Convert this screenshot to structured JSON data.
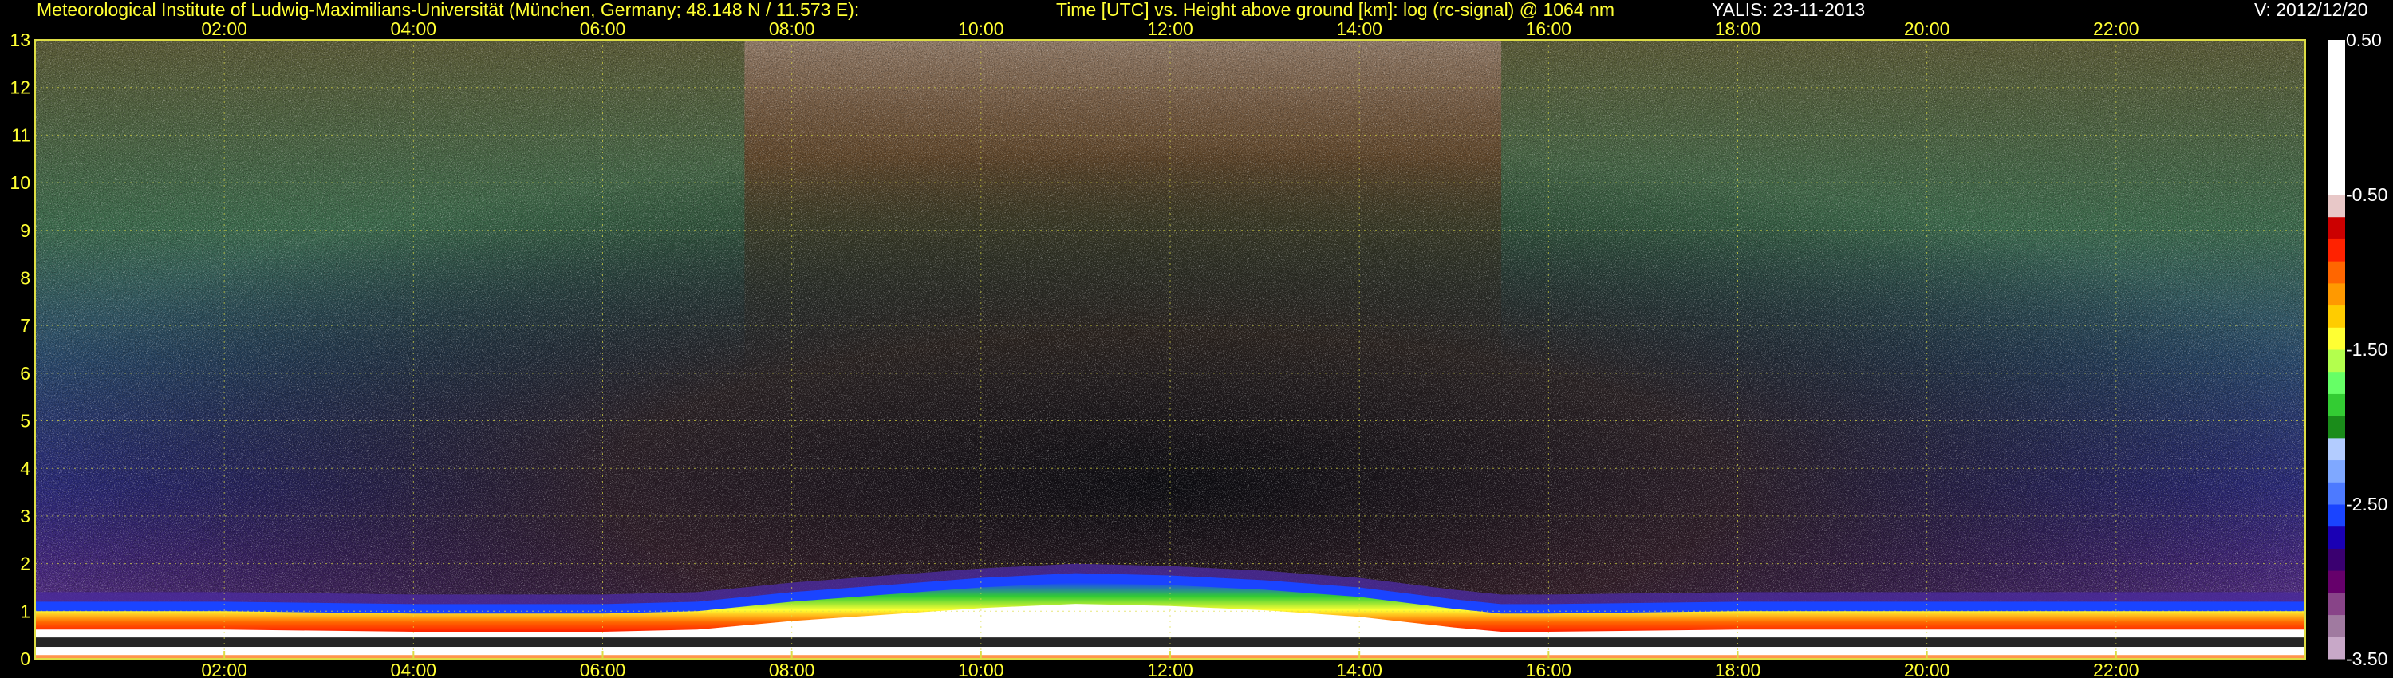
{
  "header": {
    "institute": "Meteorological Institute of Ludwig-Maximilians-Universität (München, Germany; 48.148 N / 11.573 E):",
    "plot_title": "Time [UTC] vs. Height above ground [km]: log (rc-signal) @ 1064 nm",
    "instrument_date": "YALIS: 23-11-2013",
    "version": "V: 2012/12/20"
  },
  "chart_data": {
    "type": "heatmap",
    "title": "Time [UTC] vs. Height above ground [km]: log (rc-signal) @ 1064 nm",
    "x_ticks": [
      "02:00",
      "04:00",
      "06:00",
      "08:00",
      "10:00",
      "12:00",
      "14:00",
      "16:00",
      "18:00",
      "20:00",
      "22:00"
    ],
    "x_tick_hours": [
      2,
      4,
      6,
      8,
      10,
      12,
      14,
      16,
      18,
      20,
      22
    ],
    "xlim": [
      0,
      24
    ],
    "y_ticks": [
      "0",
      "1",
      "2",
      "3",
      "4",
      "5",
      "6",
      "7",
      "8",
      "9",
      "10",
      "11",
      "12",
      "13"
    ],
    "ylim": [
      0,
      13
    ],
    "colorbar": {
      "ticks": [
        "0.50",
        "-0.50",
        "-1.50",
        "-2.50",
        "-3.50"
      ],
      "tick_values": [
        0.5,
        -0.5,
        -1.5,
        -2.5,
        -3.5
      ],
      "range": [
        -3.5,
        0.5
      ],
      "colors": [
        "#c8a8c8",
        "#a07aa0",
        "#884488",
        "#66006b",
        "#3a0070",
        "#1a00b4",
        "#1a44ff",
        "#4d7aff",
        "#7fa8ff",
        "#b3ccff",
        "#1a8c1a",
        "#33cc33",
        "#66ff66",
        "#b3ff4d",
        "#ffff33",
        "#ffcc00",
        "#ff9900",
        "#ff6600",
        "#ff2200",
        "#cc0000",
        "#e8c8c8",
        "#ffffff"
      ]
    },
    "boundary_layer_top_km": [
      {
        "t": 0.0,
        "h": 0.85
      },
      {
        "t": 2.0,
        "h": 0.85
      },
      {
        "t": 4.0,
        "h": 0.8
      },
      {
        "t": 6.0,
        "h": 0.8
      },
      {
        "t": 7.0,
        "h": 0.85
      },
      {
        "t": 8.0,
        "h": 1.05
      },
      {
        "t": 9.0,
        "h": 1.2
      },
      {
        "t": 10.0,
        "h": 1.35
      },
      {
        "t": 11.0,
        "h": 1.45
      },
      {
        "t": 12.0,
        "h": 1.4
      },
      {
        "t": 13.0,
        "h": 1.3
      },
      {
        "t": 14.0,
        "h": 1.15
      },
      {
        "t": 15.0,
        "h": 0.9
      },
      {
        "t": 15.5,
        "h": 0.8
      },
      {
        "t": 16.0,
        "h": 0.8
      },
      {
        "t": 18.0,
        "h": 0.85
      },
      {
        "t": 20.0,
        "h": 0.85
      },
      {
        "t": 22.0,
        "h": 0.85
      },
      {
        "t": 24.0,
        "h": 0.85
      }
    ],
    "grid": true
  }
}
